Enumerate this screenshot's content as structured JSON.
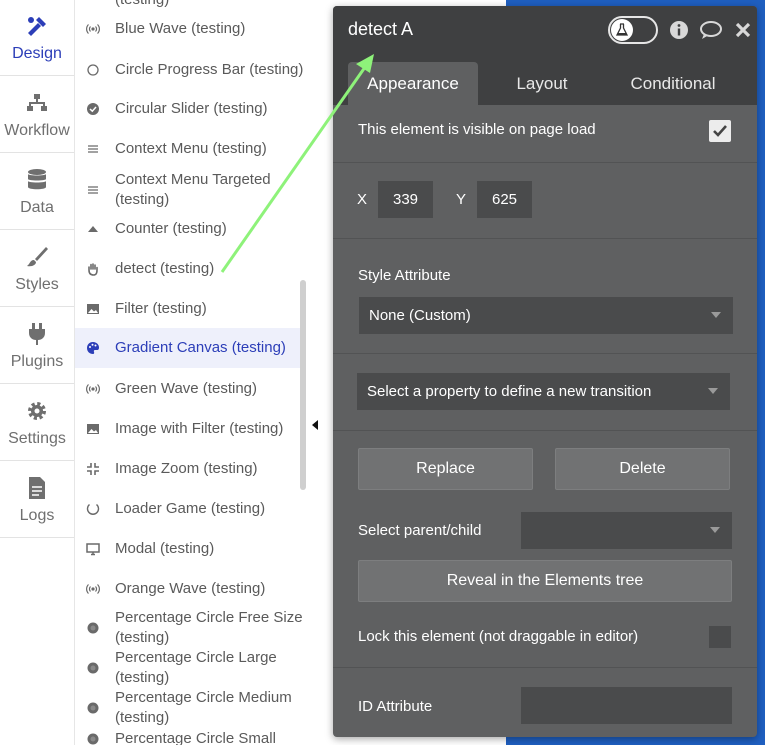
{
  "rail": {
    "items": [
      {
        "label": "Design",
        "icon": "design-icon",
        "active": true
      },
      {
        "label": "Workflow",
        "icon": "workflow-icon",
        "active": false
      },
      {
        "label": "Data",
        "icon": "database-icon",
        "active": false
      },
      {
        "label": "Styles",
        "icon": "brush-icon",
        "active": false
      },
      {
        "label": "Plugins",
        "icon": "plug-icon",
        "active": false
      },
      {
        "label": "Settings",
        "icon": "gear-icon",
        "active": false
      },
      {
        "label": "Logs",
        "icon": "document-icon",
        "active": false
      }
    ]
  },
  "elements": {
    "items": [
      {
        "label": "(testing)",
        "icon": "bar-icon"
      },
      {
        "label": "Blue Wave (testing)",
        "icon": "wave-icon"
      },
      {
        "label": "Circle Progress Bar (testing)",
        "icon": "circle-outline-icon"
      },
      {
        "label": "Circular Slider (testing)",
        "icon": "check-circle-icon"
      },
      {
        "label": "Context Menu (testing)",
        "icon": "menu-lines-icon"
      },
      {
        "label": "Context Menu Targeted (testing)",
        "icon": "menu-lines-icon"
      },
      {
        "label": "Counter (testing)",
        "icon": "triangle-up-icon"
      },
      {
        "label": "detect (testing)",
        "icon": "hand-icon"
      },
      {
        "label": "Filter (testing)",
        "icon": "image-icon"
      },
      {
        "label": "Gradient Canvas (testing)",
        "icon": "palette-icon"
      },
      {
        "label": "Green Wave (testing)",
        "icon": "wave-icon"
      },
      {
        "label": "Image with Filter (testing)",
        "icon": "image-icon"
      },
      {
        "label": "Image Zoom (testing)",
        "icon": "compress-icon"
      },
      {
        "label": "Loader Game (testing)",
        "icon": "circle-notch-icon"
      },
      {
        "label": "Modal (testing)",
        "icon": "monitor-icon"
      },
      {
        "label": "Orange Wave (testing)",
        "icon": "wave-icon"
      },
      {
        "label": "Percentage Circle Free Size (testing)",
        "icon": "dot-circle-icon"
      },
      {
        "label": "Percentage Circle Large (testing)",
        "icon": "dot-circle-icon"
      },
      {
        "label": "Percentage Circle Medium (testing)",
        "icon": "dot-circle-icon"
      },
      {
        "label": "Percentage Circle Small",
        "icon": "dot-circle-icon"
      }
    ],
    "selected": "Gradient Canvas (testing)"
  },
  "editor": {
    "title": "detect A",
    "tabs": [
      "Appearance",
      "Layout",
      "Conditional"
    ],
    "active_tab": "Appearance",
    "visible_label": "This element is visible on page load",
    "visible_checked": true,
    "x_label": "X",
    "x_value": "339",
    "y_label": "Y",
    "y_value": "625",
    "style_label": "Style Attribute",
    "style_value": "None (Custom)",
    "transition_placeholder": "Select a property to define a new transition",
    "replace_label": "Replace",
    "delete_label": "Delete",
    "parent_child_label": "Select parent/child",
    "parent_child_value": "",
    "reveal_label": "Reveal in the Elements tree",
    "lock_label": "Lock this element (not draggable in editor)",
    "lock_checked": false,
    "id_label": "ID Attribute",
    "id_value": ""
  },
  "colors": {
    "accent": "#2c3eb8",
    "panel": "#5f6061",
    "panel_header": "#3f4041",
    "canvas": "#1f5fc0",
    "annotation_arrow": "#8ef27a"
  }
}
